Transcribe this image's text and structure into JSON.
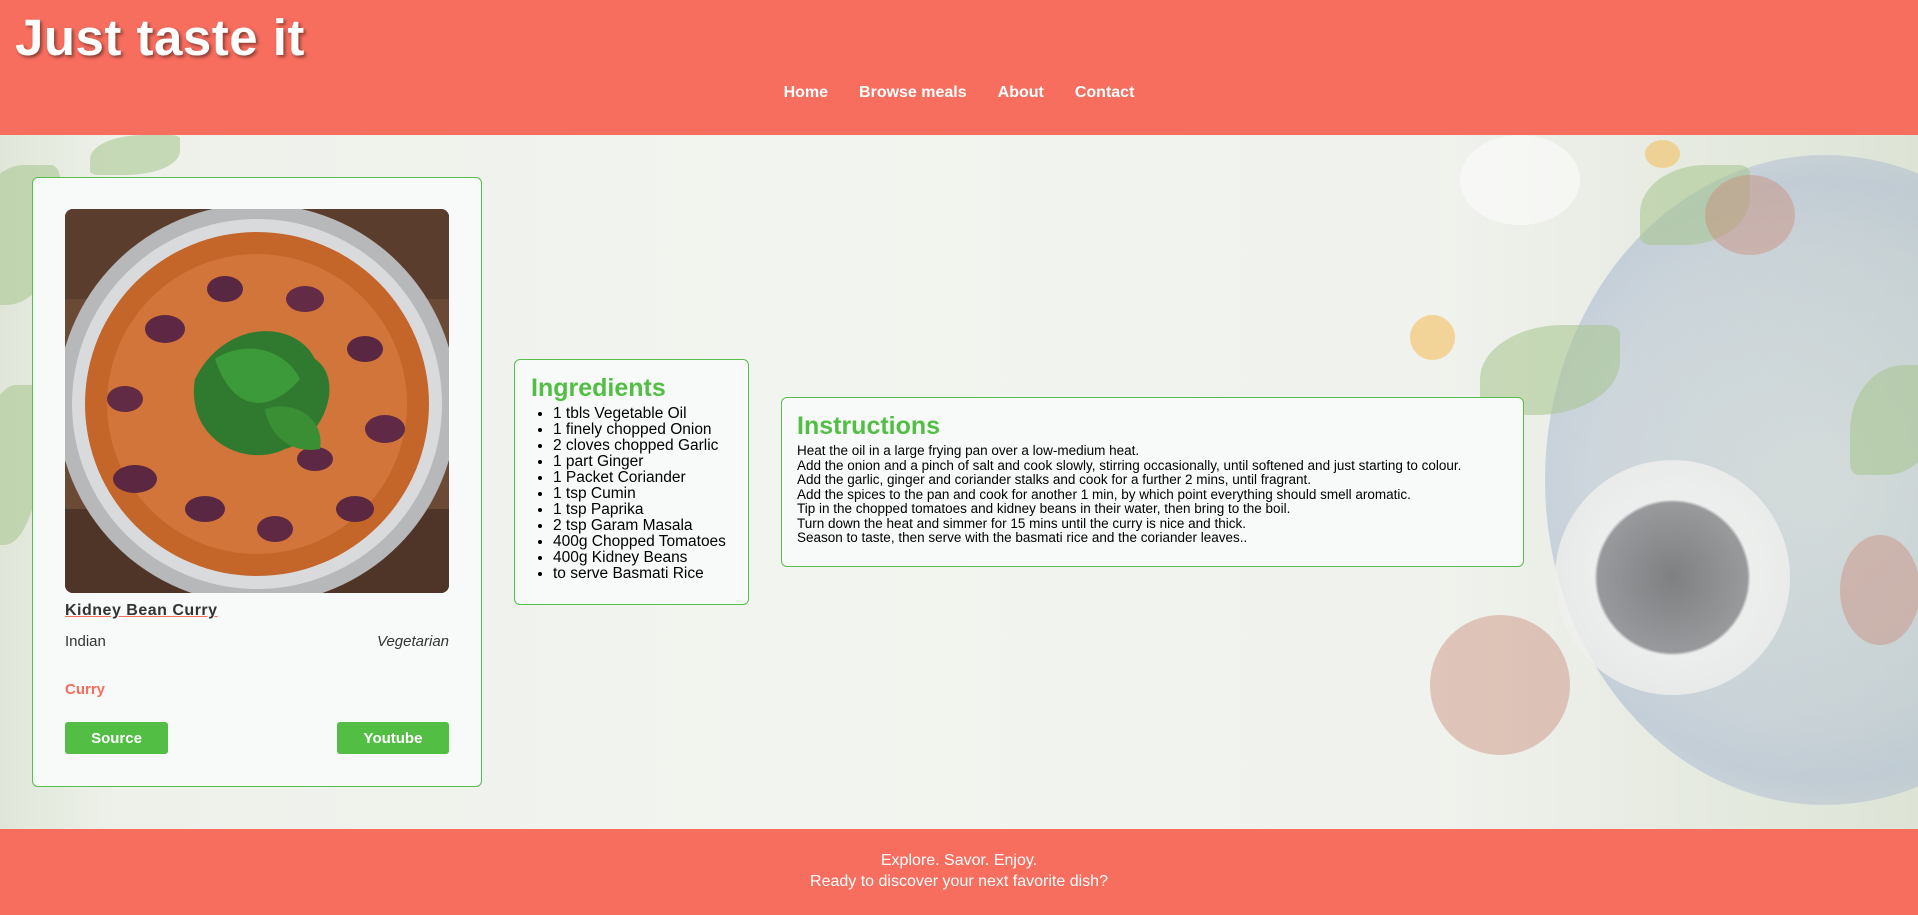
{
  "header": {
    "brand": "Just taste it",
    "nav": [
      "Home",
      "Browse meals",
      "About",
      "Contact"
    ]
  },
  "meal": {
    "name": "Kidney Bean Curry",
    "area": "Indian",
    "category": "Vegetarian",
    "tag": "Curry",
    "source_label": "Source",
    "youtube_label": "Youtube"
  },
  "ingredients": {
    "title": "Ingredients",
    "items": [
      "1 tbls Vegetable Oil",
      "1 finely chopped Onion",
      "2 cloves chopped Garlic",
      "1 part Ginger",
      "1 Packet Coriander",
      "1 tsp Cumin",
      "1 tsp Paprika",
      "2 tsp Garam Masala",
      "400g Chopped Tomatoes",
      "400g Kidney Beans",
      "to serve Basmati Rice"
    ]
  },
  "instructions": {
    "title": "Instructions",
    "lines": [
      "Heat the oil in a large frying pan over a low-medium heat.",
      "Add the onion and a pinch of salt and cook slowly, stirring occasionally, until softened and just starting to colour.",
      "Add the garlic, ginger and coriander stalks and cook for a further 2 mins, until fragrant.",
      "Add the spices to the pan and cook for another 1 min, by which point everything should smell aromatic.",
      "Tip in the chopped tomatoes and kidney beans in their water, then bring to the boil.",
      "Turn down the heat and simmer for 15 mins until the curry is nice and thick.",
      "Season to taste, then serve with the basmati rice and the coriander leaves.."
    ]
  },
  "footer": {
    "line1": "Explore. Savor. Enjoy.",
    "line2": "Ready to discover your next favorite dish?"
  },
  "colors": {
    "brand": "#f76d5e",
    "accent": "#52bf44"
  }
}
